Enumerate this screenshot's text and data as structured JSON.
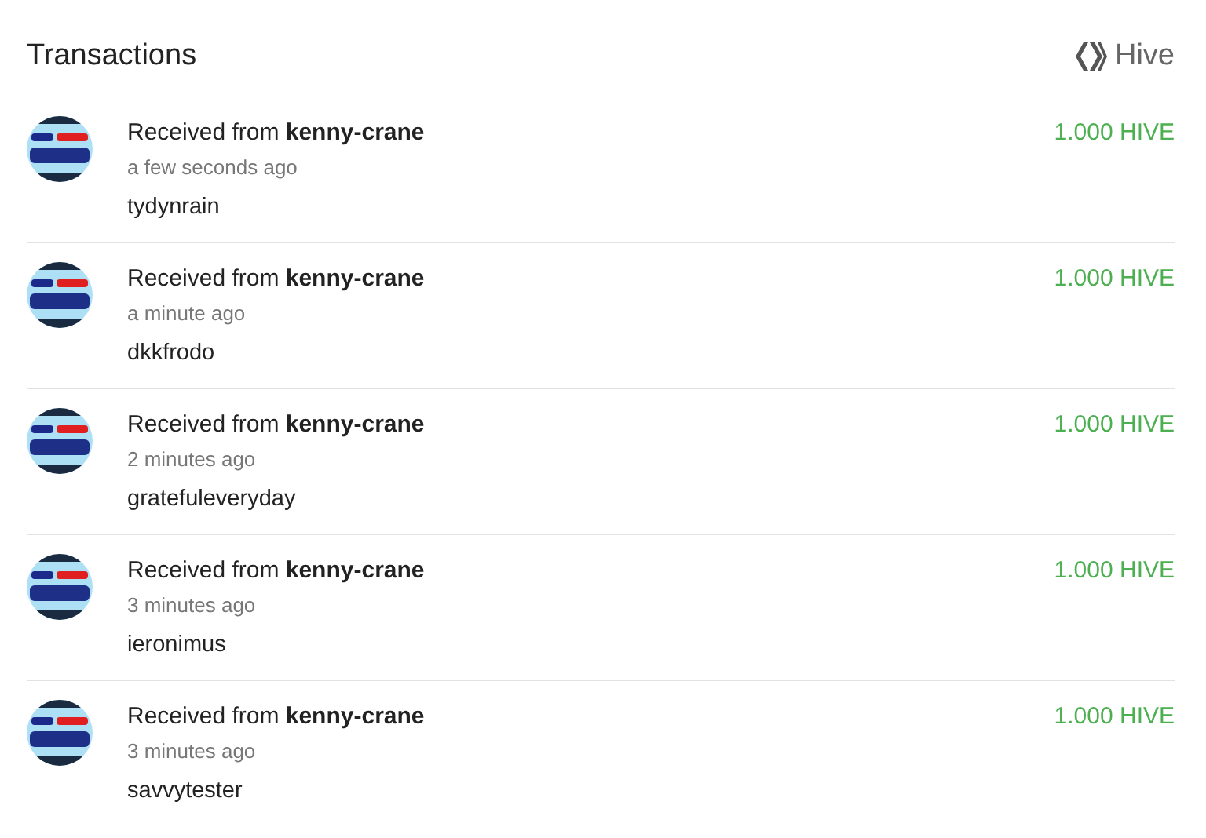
{
  "header": {
    "title": "Transactions",
    "brand": "Hive"
  },
  "transactions": [
    {
      "prefix": "Received from",
      "account": "kenny-crane",
      "time": "a few seconds ago",
      "memo": "tydynrain",
      "amount": "1.000 HIVE"
    },
    {
      "prefix": "Received from",
      "account": "kenny-crane",
      "time": "a minute ago",
      "memo": "dkkfrodo",
      "amount": "1.000 HIVE"
    },
    {
      "prefix": "Received from",
      "account": "kenny-crane",
      "time": "2 minutes ago",
      "memo": "gratefuleveryday",
      "amount": "1.000 HIVE"
    },
    {
      "prefix": "Received from",
      "account": "kenny-crane",
      "time": "3 minutes ago",
      "memo": "ieronimus",
      "amount": "1.000 HIVE"
    },
    {
      "prefix": "Received from",
      "account": "kenny-crane",
      "time": "3 minutes ago",
      "memo": "savvytester",
      "amount": "1.000 HIVE"
    }
  ]
}
